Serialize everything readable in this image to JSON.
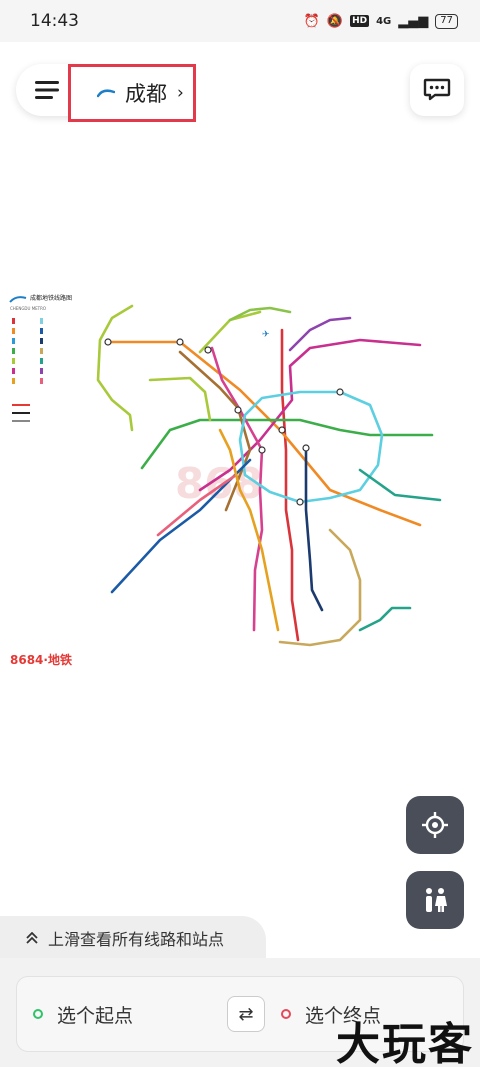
{
  "status": {
    "time": "14:43",
    "hd": "HD",
    "signal": "4G",
    "battery": "77"
  },
  "header": {
    "city": "成都",
    "chevron": "›"
  },
  "map": {
    "legend_title": "成都地铁线路图",
    "legend_subtitle": "CHENGDU METRO",
    "brand": "8684·地铁",
    "line_colors": [
      "#d9343a",
      "#f08a24",
      "#2b9bd8",
      "#3cae49",
      "#a7c93a",
      "#c82f8f",
      "#e5a11f",
      "#7fd0e0",
      "#1a5aa6",
      "#1b3a6e",
      "#c8a85a",
      "#24a28a",
      "#8e44ad",
      "#e8607c"
    ]
  },
  "actions": {
    "locate_icon": "crosshair-icon",
    "toilet_icon": "restroom-icon"
  },
  "bottom": {
    "swipe_hint": "上滑查看所有线路和站点",
    "start_placeholder": "选个起点",
    "end_placeholder": "选个终点",
    "swap_symbol": "⇄"
  },
  "watermark": "大玩客"
}
